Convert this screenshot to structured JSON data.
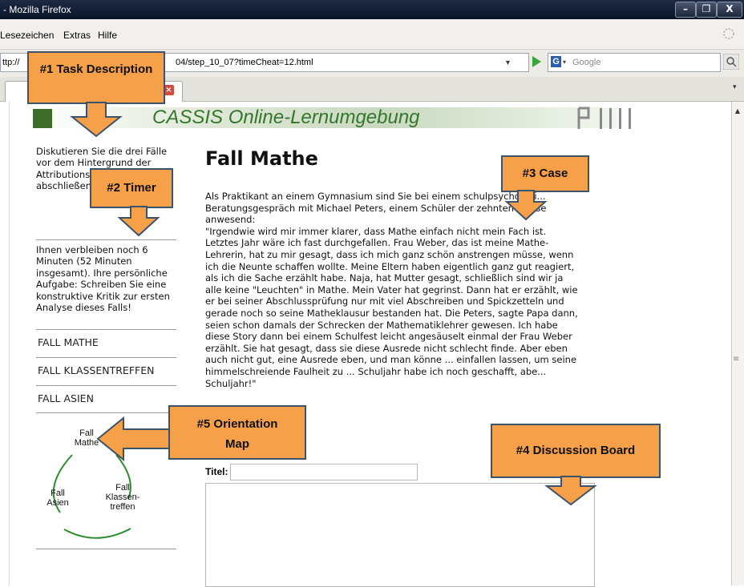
{
  "window": {
    "title": "- Mozilla Firefox",
    "min_label": "–",
    "max_label": "❐",
    "close_label": "X"
  },
  "menubar": {
    "items": [
      "Lesezeichen",
      "Extras",
      "Hilfe"
    ]
  },
  "navbar": {
    "url_prefix": "ttp://",
    "url_suffix": "04/step_10_07?timeCheat=12.html",
    "search_placeholder": "Google"
  },
  "header": {
    "title": "CASSIS Online-Lernumgebung"
  },
  "sidebar": {
    "task_description": "Diskutieren Sie die drei Fälle vor dem Hintergrund der Attributions... erstellen Sie... abschließen... jedem Fall!",
    "timer_text": "Ihnen verbleiben noch 6 Minuten (52 Minuten insgesamt). Ihre persönliche Aufgabe: Schreiben Sie eine konstruktive Kritik zur ersten Analyse dieses Falls!",
    "cases": [
      "FALL MATHE",
      "FALL KLASSENTREFFEN",
      "FALL ASIEN"
    ],
    "map": {
      "mathe": "Fall Mathe",
      "asien": "Fall Asien",
      "klassentreffen": "Fall Klassen-treffen"
    }
  },
  "main": {
    "case_title": "Fall Mathe",
    "intro": "Als Praktikant an einem Gymnasium sind Sie bei einem schulpsychologi... Beratungsgespräch mit Michael Peters, einem Schüler der zehnten Klasse anwesend:",
    "quote": "\"Irgendwie wird mir immer klarer, dass Mathe einfach nicht mein Fach ist. Letztes Jahr wäre ich fast durchgefallen. Frau Weber, das ist meine Mathe-Lehrerin, hat zu mir gesagt, dass ich mich ganz schön anstrengen müsse, wenn ich die Neunte schaffen wollte. Meine Eltern haben eigentlich ganz gut reagiert, als ich die Sache erzählt habe. Naja, hat Mutter gesagt, schließlich sind wir ja alle keine \"Leuchten\" in Mathe. Mein Vater hat gegrinst. Dann hat er erzählt, wie er bei seiner Abschlussprüfung nur mit viel Abschreiben und Spickzetteln und gerade noch so seine Matheklausur bestanden hat. Die Peters, sagte Papa dann, seien schon damals der Schrecken der Mathematiklehrer gewesen. Ich habe diese Story dann bei einem Schulfest leicht angesäuselt einmal der Frau Weber erzählt. Sie hat gesagt, dass sie diese Ausrede nicht schlecht finde. Aber eben auch nicht gut, eine Ausrede eben, und man könne ... einfallen lassen, um seine himmelschreiende Faulheit zu ... Schuljahr habe ich noch geschafft, abe... Schuljahr!\"",
    "titel_label": "Titel:",
    "titel_value": "",
    "discussion_value": ""
  },
  "callouts": {
    "task": "#1 Task Description",
    "timer": "#2 Timer",
    "case": "#3 Case",
    "discussion": "#4 Discussion Board",
    "orientation": "#5 Orientation Map"
  },
  "colors": {
    "callout_fill": "#f7a04a",
    "callout_border": "#3d526b",
    "header_green": "#35762d",
    "map_arc": "#2e8b2e"
  }
}
